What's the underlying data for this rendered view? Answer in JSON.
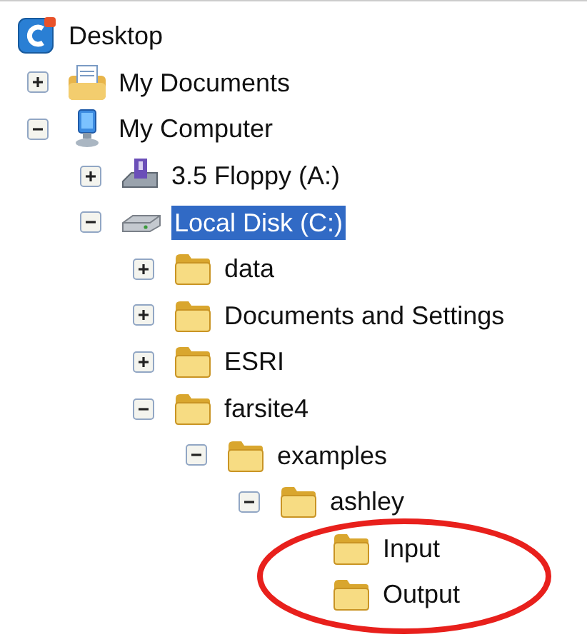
{
  "tree": [
    {
      "label": "Desktop",
      "kind": "desktop",
      "selected": false,
      "children": [
        {
          "label": "My Documents",
          "kind": "documents",
          "expanded": false,
          "selected": false
        },
        {
          "label": "My Computer",
          "kind": "computer",
          "expanded": true,
          "selected": false,
          "children": [
            {
              "label": "3.5 Floppy (A:)",
              "kind": "floppy",
              "expanded": false,
              "selected": false
            },
            {
              "label": "Local Disk (C:)",
              "kind": "disk",
              "expanded": true,
              "selected": true,
              "children": [
                {
                  "label": "data",
                  "kind": "folder",
                  "expanded": false,
                  "selected": false
                },
                {
                  "label": "Documents and Settings",
                  "kind": "folder",
                  "expanded": false,
                  "selected": false
                },
                {
                  "label": "ESRI",
                  "kind": "folder",
                  "expanded": false,
                  "selected": false
                },
                {
                  "label": "farsite4",
                  "kind": "folder",
                  "expanded": true,
                  "selected": false,
                  "children": [
                    {
                      "label": "examples",
                      "kind": "folder",
                      "expanded": true,
                      "selected": false,
                      "children": [
                        {
                          "label": "ashley",
                          "kind": "folder",
                          "expanded": true,
                          "selected": false,
                          "children": [
                            {
                              "label": "Input",
                              "kind": "folder",
                              "selected": false
                            },
                            {
                              "label": "Output",
                              "kind": "folder",
                              "selected": false
                            }
                          ]
                        }
                      ]
                    }
                  ]
                }
              ]
            }
          ]
        }
      ]
    }
  ],
  "annotation": {
    "kind": "ellipse"
  }
}
